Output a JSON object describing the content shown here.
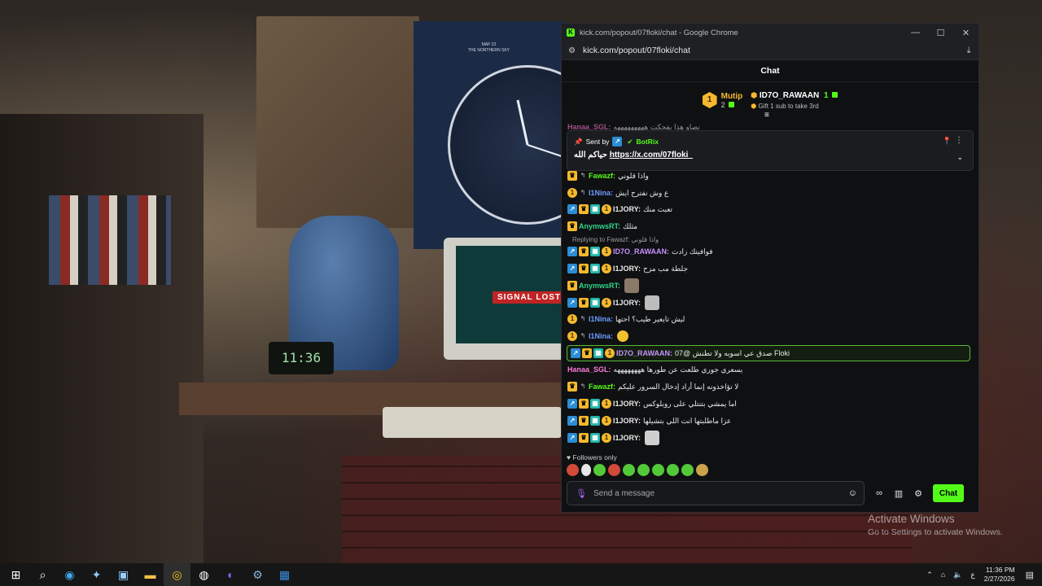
{
  "wallpaper": {
    "poster_line1": "MAP 23",
    "poster_line2": "THE NORTHERN SKY",
    "signal_text": "SIGNAL LOST",
    "clock_text": "11:36"
  },
  "watermark": {
    "line1": "Activate Windows",
    "line2": "Go to Settings to activate Windows."
  },
  "browser": {
    "window_title": "kick.com/popout/07floki/chat - Google Chrome",
    "url": "kick.com/popout/07floki/chat",
    "minimize_glyph": "—",
    "maximize_glyph": "☐",
    "close_glyph": "✕"
  },
  "chat": {
    "header": "Chat",
    "leaderboard": {
      "rank": "1",
      "left_name": "Mutip",
      "left_count": "2",
      "right_name": "ID7O_RAWAAN",
      "right_count": "1",
      "subtext": "Gift 1 sub to take 3rd"
    },
    "pinned": {
      "sent_by_label": "Sent by",
      "bot_name": "BotRix",
      "message_prefix": "حياكم الله",
      "link": "https://x.com/07floki_"
    },
    "partial_top": {
      "user": "Hanaa_SGL:",
      "text": "نصاو هذا يفحكت هههههههههه"
    },
    "messages": [
      {
        "user": "Fawazf:",
        "text": "واذا قلوني"
      },
      {
        "user": "I1Nina:",
        "text": "ع وش نفترح ايش"
      },
      {
        "user": "I1JORY:",
        "text": "تعبت منك"
      },
      {
        "user": "AnymwsRT:",
        "text": "مثلك"
      },
      {
        "user": "ID7O_RAWAAN:",
        "text": "فوافيتك زادت"
      },
      {
        "user": "I1JORY:",
        "text": "جلطة مب مزح"
      },
      {
        "user": "AnymwsRT:",
        "text": ""
      },
      {
        "user": "I1JORY:",
        "text": ""
      },
      {
        "user": "I1Nina:",
        "text": "ليش تايعير طيب؟ احتها"
      },
      {
        "user": "I1Nina:",
        "text": ""
      },
      {
        "user": "ID7O_RAWAAN:",
        "text": "07@ صدق عي اسويه ولا تطنش Floki"
      },
      {
        "user": "Hanaa_SGL:",
        "text": "يسعري جوري طلعت عن طورها ههههههههه"
      },
      {
        "user": "Fawazf:",
        "text": "لا تؤاخذونه إنما أراد إدخال السرور عليكم"
      },
      {
        "user": "I1JORY:",
        "text": "اما يمشي بتنتلي على روبلوكس"
      },
      {
        "user": "I1JORY:",
        "text": "عزا ماطلبتها انت اللي بتشيلها"
      },
      {
        "user": "I1JORY:",
        "text": ""
      }
    ],
    "reply_label": "Replying to Fawazf: واذا قلوني",
    "followers_only": "Followers only",
    "input_placeholder": "Send a message",
    "send_button": "Chat"
  },
  "taskbar": {
    "lang": "ع",
    "time": "11:36 PM",
    "date": "2/27/2026"
  },
  "colors": {
    "kick_green": "#53fc18",
    "gold": "#f5b82e",
    "user_green": "#53fc18",
    "user_pink": "#ff7ad9",
    "user_blue": "#6c9bff"
  }
}
